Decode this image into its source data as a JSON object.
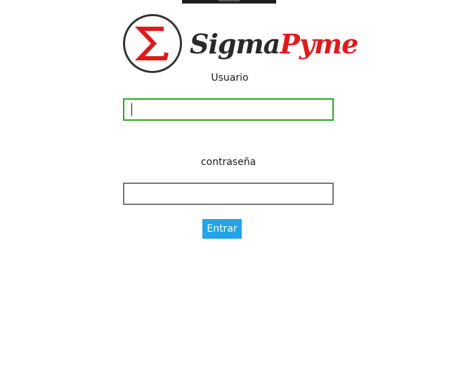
{
  "brand": {
    "logo_word_primary": "Sigma",
    "logo_word_accent": "Pyme",
    "logo_symbol": "Σ",
    "accent_color": "#e0191c",
    "dark_color": "#2a2a2a"
  },
  "form": {
    "username_label": "Usuario",
    "username_value": "",
    "username_placeholder": "",
    "password_label": "contraseña",
    "password_value": "",
    "password_placeholder": "",
    "submit_label": "Entrar",
    "button_color": "#23a4e8",
    "focus_border_color": "#2aa52a"
  },
  "icons": {
    "logo": "sigma-icon",
    "caret": "text-caret"
  }
}
